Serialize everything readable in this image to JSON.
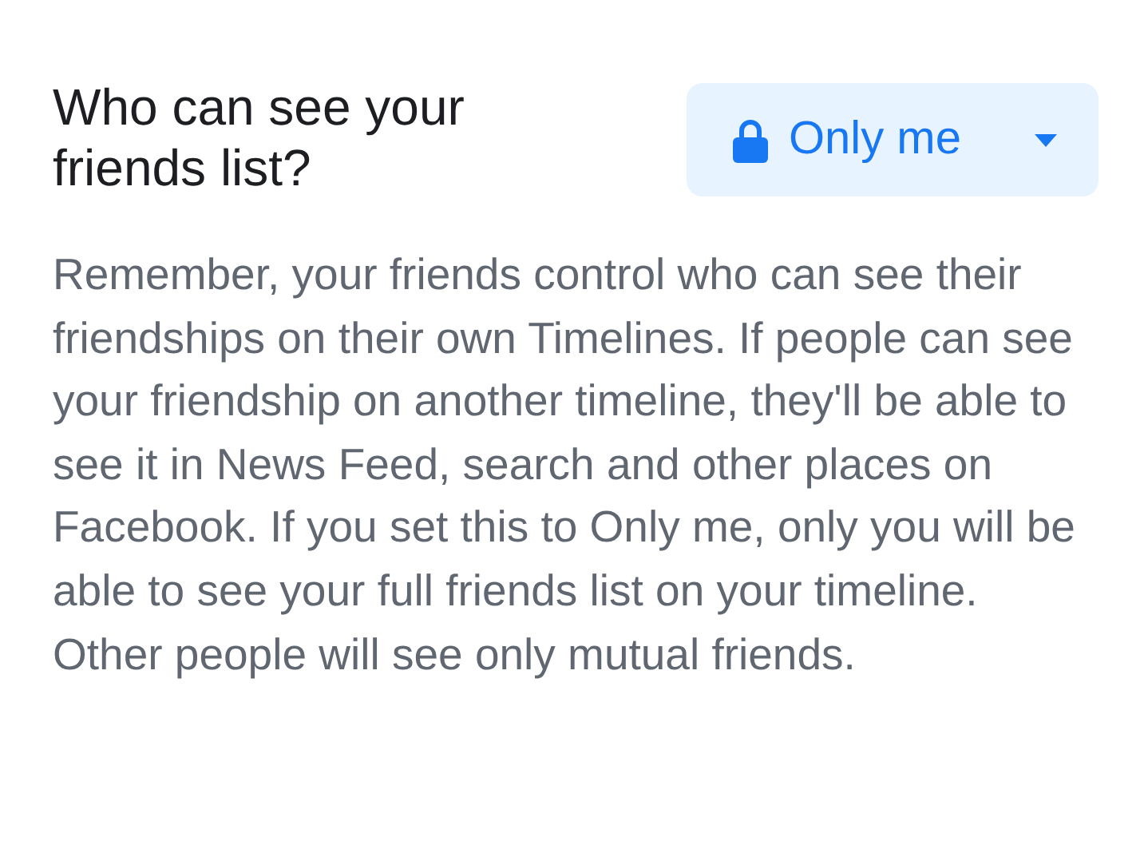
{
  "setting": {
    "question": "Who can see your friends list?",
    "audience_selector": {
      "label": "Only me"
    },
    "description": "Remember, your friends control who can see their friendships on their own Timelines. If people can see your friendship on another timeline, they'll be able to see it in News Feed, search and other places on Facebook. If you set this to Only me, only you will be able to see your full friends list on your timeline. Other people will see only mutual friends."
  }
}
